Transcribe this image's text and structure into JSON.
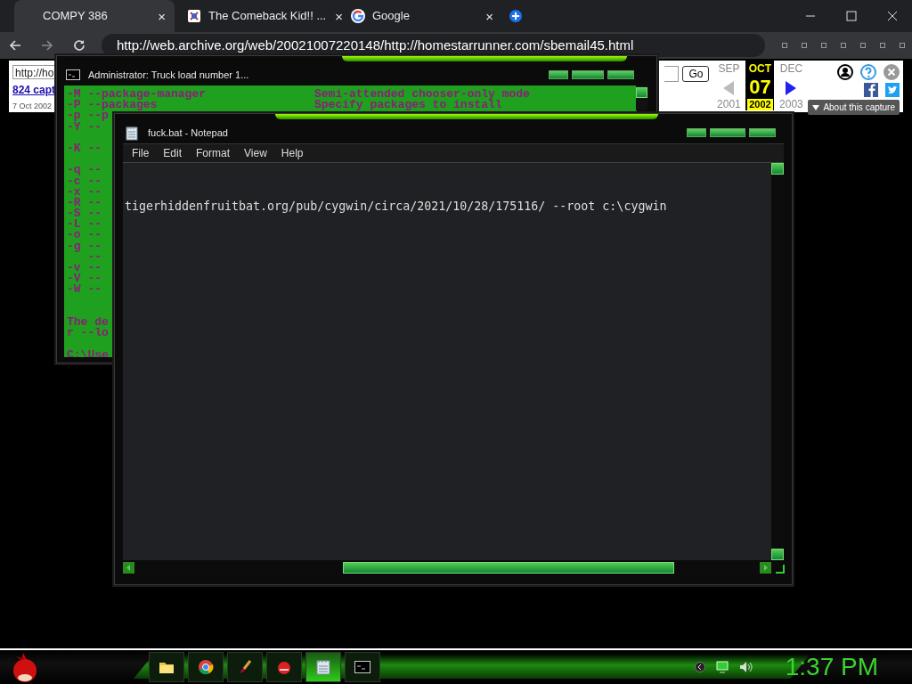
{
  "browser": {
    "tabs": [
      {
        "label": "COMPY 386",
        "selected": true,
        "close": "×"
      },
      {
        "label": "The Comeback Kid!! ...",
        "selected": false,
        "close": "×"
      },
      {
        "label": "Google",
        "selected": false,
        "close": "×"
      }
    ],
    "address": "http://web.archive.org/web/20021007220148/http://homestarrunner.com/sbemail45.html"
  },
  "wayback": {
    "url_value": "http://ho",
    "captures_link": "824 capt",
    "capture_date": "7 Oct 2002",
    "go": "Go",
    "months": [
      {
        "label": "SEP",
        "selected": false
      },
      {
        "label": "OCT",
        "selected": true
      },
      {
        "label": "DEC",
        "selected": false
      }
    ],
    "day": "07",
    "years": [
      {
        "label": "2001",
        "selected": false
      },
      {
        "label": "2002",
        "selected": true
      },
      {
        "label": "2003",
        "selected": false
      }
    ],
    "about": "About this capture"
  },
  "console": {
    "title": "Administrator:  Truck load number 1...",
    "lines": [
      {
        "kind": "text",
        "left": "-M --package-manager",
        "right": "Semi-attended chooser-only mode"
      },
      {
        "kind": "text",
        "left": "-P --packages",
        "right": "Specify packages to install"
      },
      {
        "kind": "text",
        "left": "-p --p"
      },
      {
        "kind": "text",
        "left": "-Y --"
      },
      {
        "kind": "blank"
      },
      {
        "kind": "text",
        "left": "-K --"
      },
      {
        "kind": "blank"
      },
      {
        "kind": "text",
        "left": "-q --"
      },
      {
        "kind": "text",
        "left": "-c --"
      },
      {
        "kind": "text",
        "left": "-x --"
      },
      {
        "kind": "text",
        "left": "-R --"
      },
      {
        "kind": "text",
        "left": "-S --"
      },
      {
        "kind": "text",
        "left": "-L --"
      },
      {
        "kind": "text",
        "left": "-o --"
      },
      {
        "kind": "text",
        "left": "-g --"
      },
      {
        "kind": "text",
        "left": "   --"
      },
      {
        "kind": "text",
        "left": "-v --"
      },
      {
        "kind": "text",
        "left": "-V --"
      },
      {
        "kind": "text",
        "left": "-W --"
      },
      {
        "kind": "blank"
      },
      {
        "kind": "blank"
      },
      {
        "kind": "text",
        "left": "The de"
      },
      {
        "kind": "text",
        "left": "r --lo"
      },
      {
        "kind": "blank"
      },
      {
        "kind": "text",
        "left": "C:\\Use"
      }
    ]
  },
  "notepad": {
    "title": "fuck.bat - Notepad",
    "menu": [
      "File",
      "Edit",
      "Format",
      "View",
      "Help"
    ],
    "text": "tigerhiddenfruitbat.org/pub/cygwin/circa/2021/10/28/175116/ --root c:\\cygwin"
  },
  "taskbar": {
    "apps": [
      {
        "kind": "folder",
        "selected": false
      },
      {
        "kind": "browser",
        "selected": false
      },
      {
        "kind": "paint",
        "selected": false
      },
      {
        "kind": "game",
        "selected": false
      },
      {
        "kind": "notepad",
        "selected": true
      },
      {
        "kind": "console",
        "selected": false
      }
    ],
    "clock": "1:37 PM"
  }
}
